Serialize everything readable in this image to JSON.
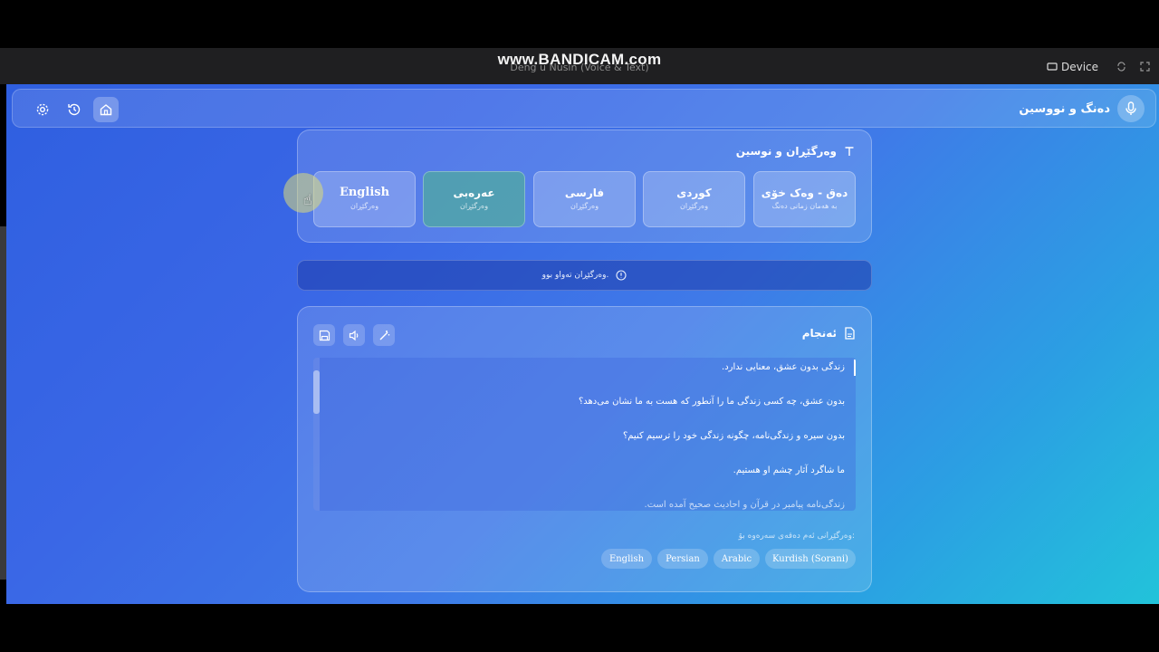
{
  "titlebar": {
    "watermark": "www.BANDICAM.com",
    "window_title": "Deng u Nusin (Voice & Text)",
    "device_label": "Device"
  },
  "navbar": {
    "brand_title": "دەنگ و نووسین",
    "icons": [
      "settings-icon",
      "history-icon",
      "home-icon"
    ]
  },
  "translate_card": {
    "heading": "وەرگێڕان و نوسین",
    "options": [
      {
        "label": "دەق - وەک خۆی",
        "sub": "بە هەمان زمانی دەنگ"
      },
      {
        "label": "کوردی",
        "sub": "وەرگێڕان"
      },
      {
        "label": "فارسی",
        "sub": "وەرگێڕان"
      },
      {
        "label": "عەرەبی",
        "sub": "وەرگێڕان"
      },
      {
        "label": "English",
        "sub": "وەرگێڕان"
      }
    ]
  },
  "status": {
    "message": "وەرگێڕان تەواو بوو."
  },
  "result_card": {
    "heading": "ئەنجام",
    "lines": [
      "زندگی بدون عشق، معنایی ندارد.",
      "بدون عشق، چه کسی زندگی ما را آنطور که هست به ما نشان می‌دهد؟",
      "بدون سیره و زندگی‌نامه، چگونه زندگی خود را ترسیم کنیم؟",
      "ما شاگرد آثار چشم او هستیم.",
      "زندگی‌نامه پیامبر در قرآن و احادیث صحیح آمده است."
    ],
    "translate_label": "وەرگێڕانی ئەم دەقەی سەرەوە بۆ:",
    "chips": [
      "Kurdish (Sorani)",
      "Arabic",
      "Persian",
      "English"
    ]
  },
  "colors": {
    "accent_active": "#50aaa0",
    "background_start": "#2f5fe0",
    "background_end": "#22c3da"
  }
}
